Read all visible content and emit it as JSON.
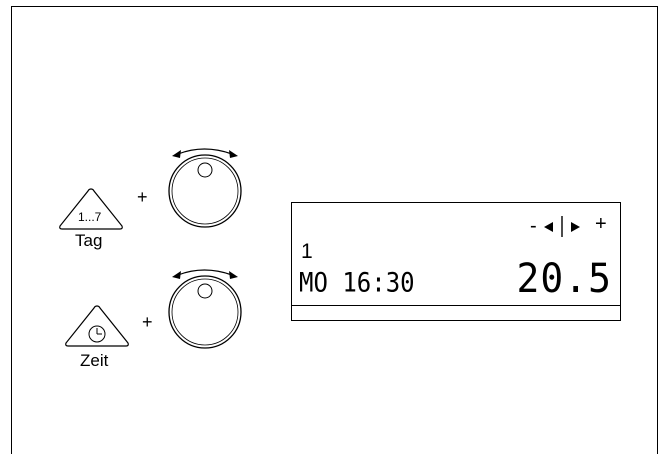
{
  "controls": {
    "day": {
      "button_text": "1...7",
      "caption": "Tag",
      "plus": "+"
    },
    "time": {
      "caption": "Zeit",
      "plus": "+",
      "icon": "clock-icon"
    },
    "knob_icon": "rotary-knob-icon"
  },
  "display": {
    "minus": "-",
    "plus": "+",
    "program_number": "1",
    "day_time": "MO 16:30",
    "temperature": "20.5"
  }
}
